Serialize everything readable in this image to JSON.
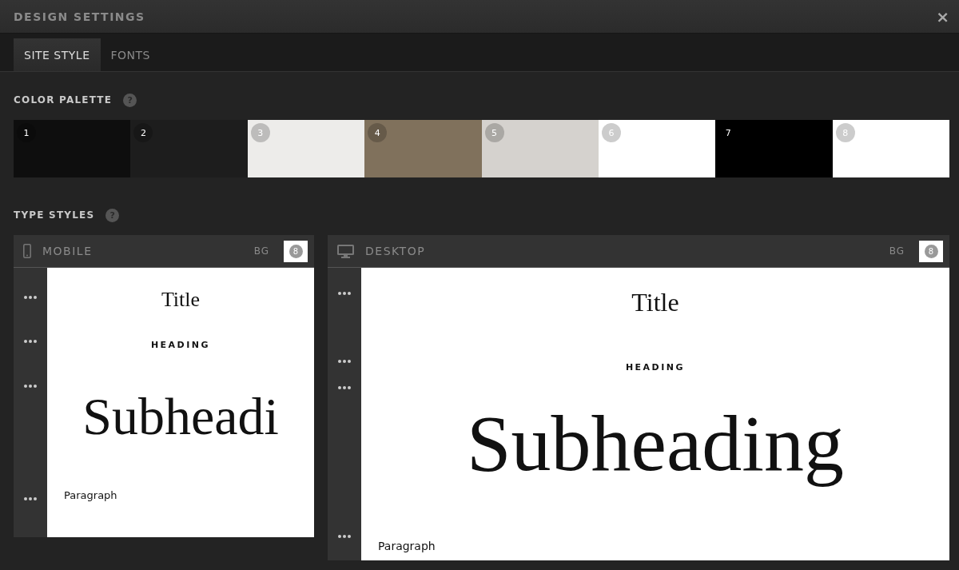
{
  "window": {
    "title": "DESIGN SETTINGS",
    "close": "×"
  },
  "tabs": [
    {
      "label": "SITE STYLE",
      "selected": true
    },
    {
      "label": "FONTS",
      "selected": false
    }
  ],
  "color_palette": {
    "label": "COLOR PALETTE",
    "help": "?",
    "swatches": [
      {
        "number": "1",
        "color": "#0e0e0e"
      },
      {
        "number": "2",
        "color": "#1d1d1d"
      },
      {
        "number": "3",
        "color": "#edecea"
      },
      {
        "number": "4",
        "color": "#80715c"
      },
      {
        "number": "5",
        "color": "#d5d2ce"
      },
      {
        "number": "6",
        "color": "#ffffff"
      },
      {
        "number": "7",
        "color": "#000000"
      },
      {
        "number": "8",
        "color": "#ffffff"
      }
    ]
  },
  "type_styles": {
    "label": "TYPE STYLES",
    "help": "?",
    "panels": [
      {
        "kind": "mobile",
        "label": "MOBILE",
        "bg_label": "BG",
        "bg_swatch": "8",
        "styles": [
          {
            "kind": "title",
            "text": "Title"
          },
          {
            "kind": "heading",
            "text": "HEADING"
          },
          {
            "kind": "subheading",
            "text": "Subheadi"
          },
          {
            "kind": "paragraph",
            "text": "Paragraph"
          }
        ]
      },
      {
        "kind": "desktop",
        "label": "DESKTOP",
        "bg_label": "BG",
        "bg_swatch": "8",
        "styles": [
          {
            "kind": "title",
            "text": "Title"
          },
          {
            "kind": "heading",
            "text": "HEADING"
          },
          {
            "kind": "subheading",
            "text": "Subheading"
          },
          {
            "kind": "paragraph",
            "text": "Paragraph"
          }
        ]
      }
    ]
  }
}
